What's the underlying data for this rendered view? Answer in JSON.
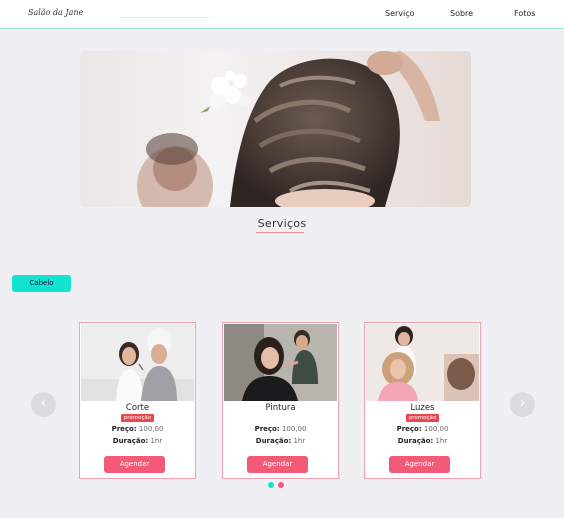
{
  "header": {
    "brand": "Salão da Jane",
    "nav": [
      "Serviço",
      "Sobre",
      "Fotos"
    ]
  },
  "services": {
    "title": "Serviços",
    "category": "Cabelo",
    "cards": [
      {
        "name": "Corte",
        "promo": "promoção",
        "price_label": "Preço:",
        "price": "100,00",
        "duration_label": "Duração:",
        "duration": "1hr",
        "button": "Agendar"
      },
      {
        "name": "Pintura",
        "promo": "",
        "price_label": "Preço:",
        "price": "100,00",
        "duration_label": "Duração:",
        "duration": "1hr",
        "button": "Agendar"
      },
      {
        "name": "Luzes",
        "promo": "promoção",
        "price_label": "Preço:",
        "price": "100,00",
        "duration_label": "Duração:",
        "duration": "1hr",
        "button": "Agendar"
      }
    ],
    "prev_icon": "‹",
    "next_icon": "›"
  },
  "colors": {
    "accent_teal": "#14e3cf",
    "accent_pink": "#f25a78",
    "promo_red": "#e9474f",
    "card_border": "#f2a2ae",
    "background": "#f0f0f4"
  },
  "icons": {
    "prev": "chevron-left-icon",
    "next": "chevron-right-icon"
  },
  "carousel": {
    "active_dot": 1,
    "dot_count": 2
  }
}
